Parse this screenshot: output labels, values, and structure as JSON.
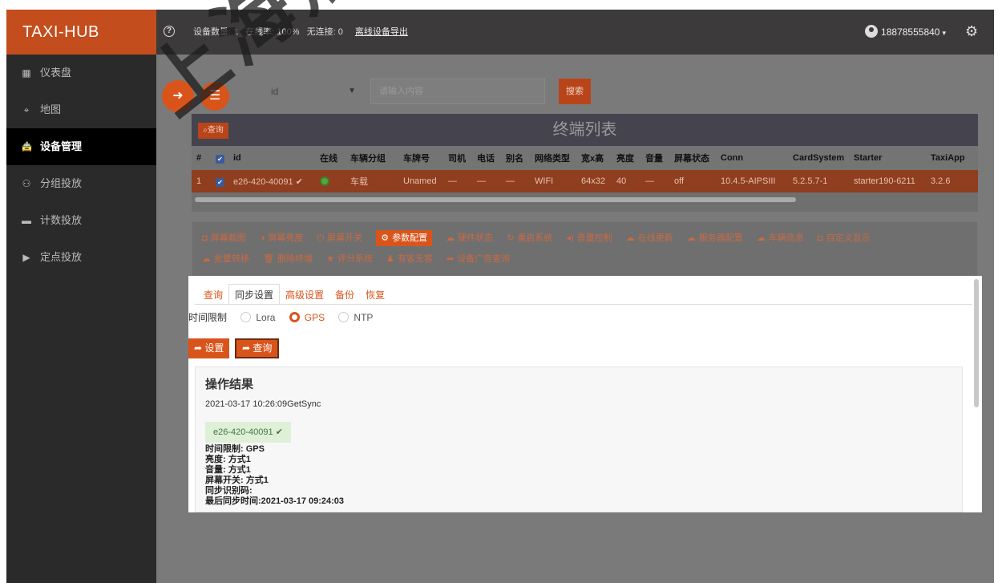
{
  "app": {
    "brand": "TAXI-HUB"
  },
  "topbar": {
    "device_count": "设备数量: 1",
    "online_rate": "在线率: 100%",
    "no_connect": "无连接: 0",
    "export": "离线设备导出",
    "user": "18878555840"
  },
  "sidebar": {
    "items": [
      {
        "label": "仪表盘",
        "icon": "dashboard-icon"
      },
      {
        "label": "地图",
        "icon": "map-icon"
      },
      {
        "label": "设备管理",
        "icon": "car-icon"
      },
      {
        "label": "分组投放",
        "icon": "group-icon"
      },
      {
        "label": "计数投放",
        "icon": "card-icon"
      },
      {
        "label": "定点投放",
        "icon": "play-icon"
      }
    ]
  },
  "search": {
    "field": "id",
    "placeholder": "请输入内容",
    "button": "搜索"
  },
  "list": {
    "query_label": "查询",
    "title": "终端列表",
    "columns": [
      "#",
      "",
      "id",
      "在线",
      "车辆分组",
      "车牌号",
      "司机",
      "电话",
      "别名",
      "网络类型",
      "宽x高",
      "亮度",
      "音量",
      "屏幕状态",
      "Conn",
      "CardSystem",
      "Starter",
      "TaxiApp"
    ],
    "row": {
      "index": "1",
      "id": "e26-420-40091",
      "group": "车载",
      "plate": "Unamed",
      "driver": "—",
      "phone": "—",
      "alias": "—",
      "network": "WIFI",
      "size": "64x32",
      "brightness": "40",
      "volume": "—",
      "screen": "off",
      "conn": "10.4.5-AIPSIII",
      "cardsystem": "5.2.5.7-1",
      "starter": "starter190-6211",
      "taxiapp": "3.2.6"
    }
  },
  "actions": {
    "row1": [
      "屏幕截图",
      "屏幕亮度",
      "屏幕开关",
      "参数配置",
      "硬件状态",
      "重启系统",
      "音量控制",
      "在线更新",
      "服务器配置",
      "车辆信息",
      "自定义显示"
    ],
    "row2": [
      "批量转移",
      "删除终端",
      "评分系统",
      "有客无客",
      "设备广告查询"
    ]
  },
  "settings": {
    "tabs": [
      "查询",
      "同步设置",
      "高级设置",
      "备份",
      "恢复"
    ],
    "time_limit_label": "时间限制",
    "options": [
      "Lora",
      "GPS",
      "NTP"
    ],
    "selected_option": "GPS",
    "set_button": "设置",
    "query_button": "查询",
    "result": {
      "heading": "操作结果",
      "timestamp": "2021-03-17 10:26:09GetSync",
      "device": "e26-420-40091",
      "lines": [
        "时间限制: GPS",
        "亮度: 方式1",
        "音量: 方式1",
        "屏幕开关: 方式1",
        "同步识别码:",
        "最后同步时间:2021-03-17 09:24:03"
      ]
    }
  },
  "watermark": "上海熙讯"
}
